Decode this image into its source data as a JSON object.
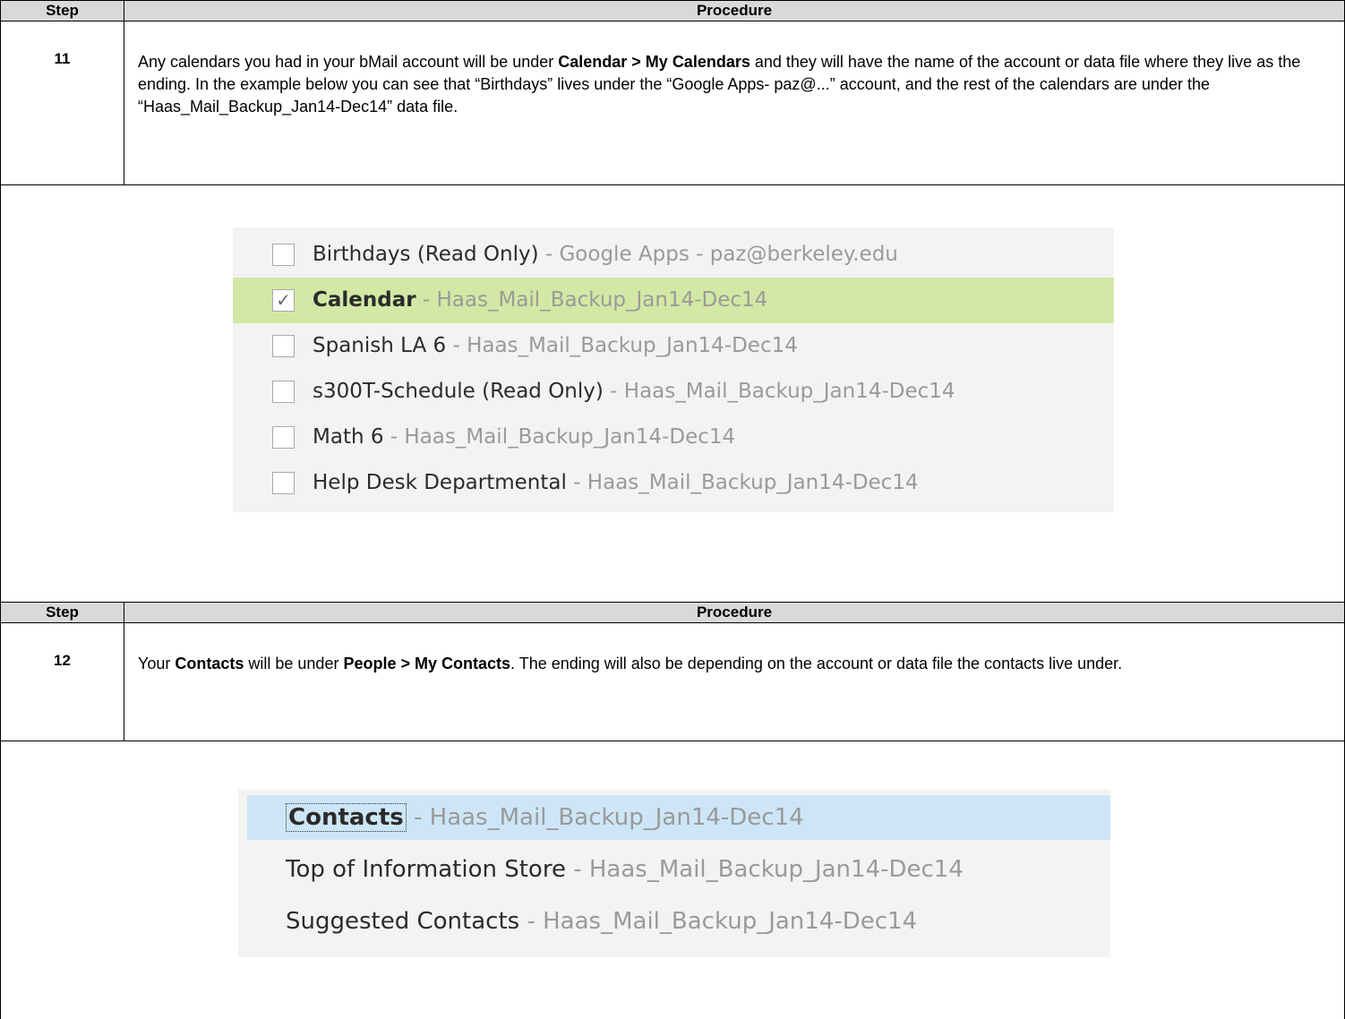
{
  "header": {
    "step": "Step",
    "procedure": "Procedure"
  },
  "step11": {
    "number": "11",
    "text_1": "Any calendars you had in your bMail account will be under ",
    "bold_1": "Calendar > My Calendars",
    "text_2": " and they will have the name of the account or data file where they live as the ending.  In the example below you can see that “Birthdays” lives under the “Google Apps- paz@...” account, and the rest of the calendars are under the “Haas_Mail_Backup_Jan14-Dec14” data file.",
    "calendars": [
      {
        "name": "Birthdays (Read Only)",
        "suffix": " - Google Apps - paz@berkeley.edu",
        "checked": false
      },
      {
        "name": "Calendar",
        "suffix": " - Haas_Mail_Backup_Jan14-Dec14",
        "checked": true
      },
      {
        "name": "Spanish LA 6",
        "suffix": " - Haas_Mail_Backup_Jan14-Dec14",
        "checked": false
      },
      {
        "name": "s300T-Schedule (Read Only)",
        "suffix": " - Haas_Mail_Backup_Jan14-Dec14",
        "checked": false
      },
      {
        "name": "Math 6",
        "suffix": " - Haas_Mail_Backup_Jan14-Dec14",
        "checked": false
      },
      {
        "name": "Help Desk Departmental",
        "suffix": " - Haas_Mail_Backup_Jan14-Dec14",
        "checked": false
      }
    ],
    "checkmark": "✓"
  },
  "step12": {
    "number": "12",
    "text_1": "Your ",
    "bold_1": "Contacts",
    "text_2": " will be under ",
    "bold_2": "People > My Contacts",
    "text_3": ".  The ending will also be depending on the account or data file the contacts live under.",
    "contacts": [
      {
        "name": "Contacts",
        "suffix": " - Haas_Mail_Backup_Jan14-Dec14"
      },
      {
        "name": "Top of Information Store",
        "suffix": " - Haas_Mail_Backup_Jan14-Dec14"
      },
      {
        "name": "Suggested Contacts",
        "suffix": " - Haas_Mail_Backup_Jan14-Dec14"
      }
    ]
  },
  "colors": {
    "header_bg": "#d9d9d9",
    "calendar_selected": "#d3e8a5",
    "contacts_selected": "#cde6f7",
    "suffix_gray": "#9a9a9a"
  }
}
